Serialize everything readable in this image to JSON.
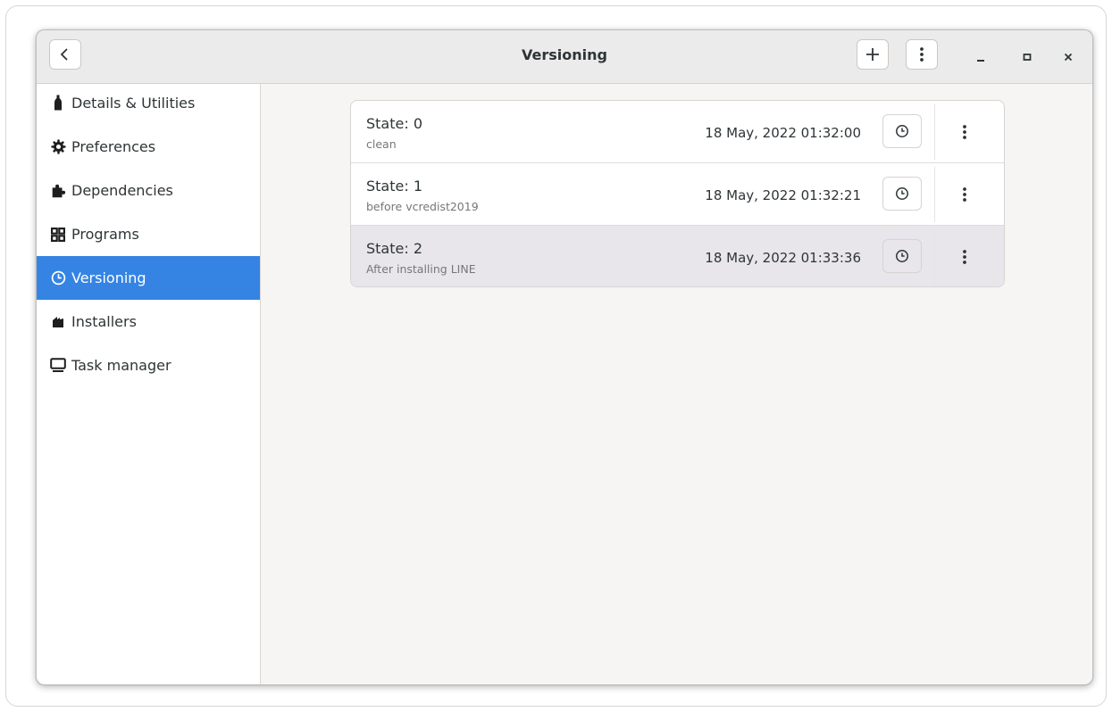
{
  "window": {
    "title": "Versioning"
  },
  "sidebar": {
    "items": [
      {
        "label": "Details & Utilities",
        "icon": "bottle-icon"
      },
      {
        "label": "Preferences",
        "icon": "gear-icon"
      },
      {
        "label": "Dependencies",
        "icon": "puzzle-icon"
      },
      {
        "label": "Programs",
        "icon": "grid-icon"
      },
      {
        "label": "Versioning",
        "icon": "clock-icon",
        "active": true
      },
      {
        "label": "Installers",
        "icon": "box-icon"
      },
      {
        "label": "Task manager",
        "icon": "monitor-icon"
      }
    ]
  },
  "states": [
    {
      "title": "State: 0",
      "subtitle": "clean",
      "date": "18 May, 2022 01:32:00"
    },
    {
      "title": "State: 1",
      "subtitle": "before vcredist2019",
      "date": "18 May, 2022 01:32:21"
    },
    {
      "title": "State: 2",
      "subtitle": "After installing LINE",
      "date": "18 May, 2022 01:33:36",
      "selected": true
    }
  ],
  "colors": {
    "accent": "#3584e4",
    "headerbar": "#ebebeb",
    "content_bg": "#f6f5f4",
    "selected_row": "#e8e6eb"
  }
}
